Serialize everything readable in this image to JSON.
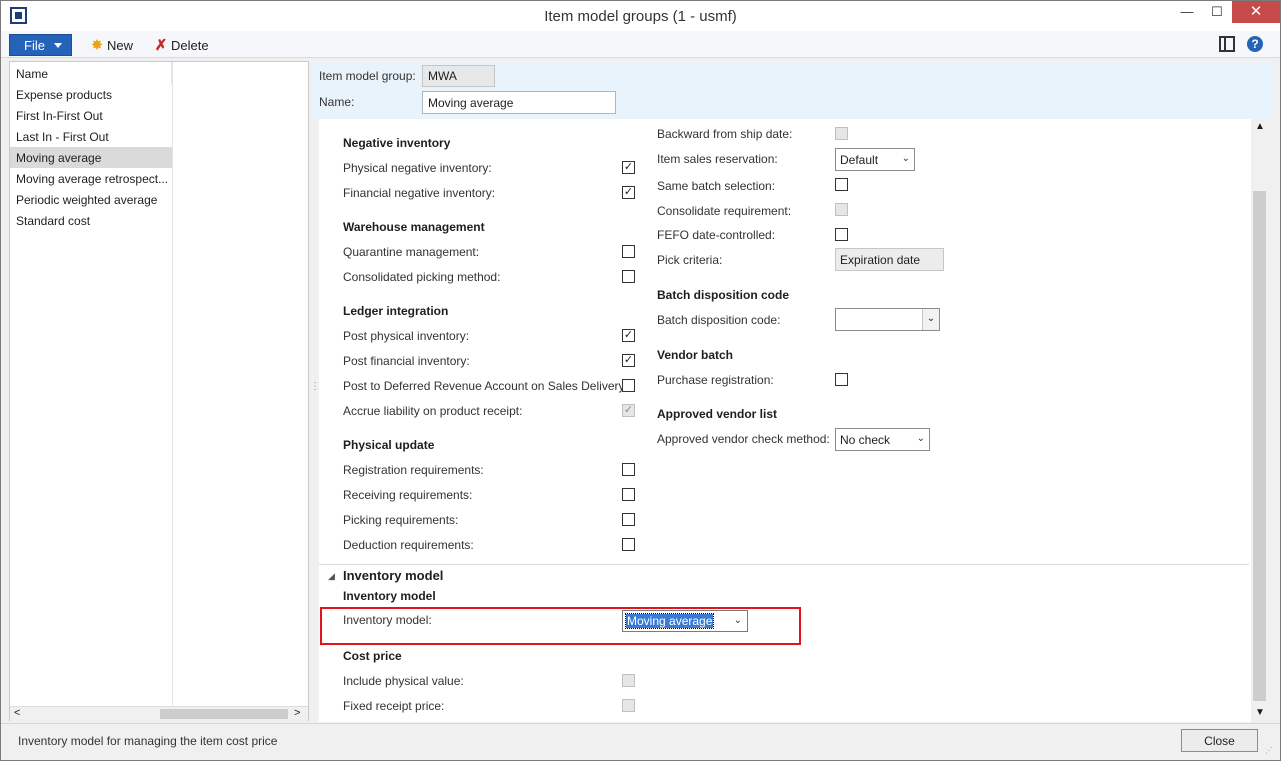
{
  "window": {
    "title": "Item model groups (1 - usmf)",
    "close_glyph": "✕",
    "min_glyph": "—",
    "max_glyph": "☐"
  },
  "toolbar": {
    "file_label": "File",
    "new_label": "New",
    "delete_label": "Delete",
    "help_glyph": "?"
  },
  "list": {
    "header": "Name",
    "items": [
      "Expense products",
      "First In-First Out",
      "Last In - First Out",
      "Moving average",
      "Moving average retrospect...",
      "Periodic weighted average",
      "Standard cost"
    ],
    "selected_index": 3
  },
  "header_fields": {
    "group_label": "Item model group:",
    "group_value": "MWA",
    "name_label": "Name:",
    "name_value": "Moving average"
  },
  "left_col": {
    "negative_inventory": {
      "title": "Negative inventory",
      "physical_label": "Physical negative inventory:",
      "physical_checked": true,
      "financial_label": "Financial negative inventory:",
      "financial_checked": true
    },
    "warehouse": {
      "title": "Warehouse management",
      "quarantine_label": "Quarantine management:",
      "quarantine_checked": false,
      "consolidated_label": "Consolidated picking method:",
      "consolidated_checked": false
    },
    "ledger": {
      "title": "Ledger integration",
      "post_physical_label": "Post physical inventory:",
      "post_physical_checked": true,
      "post_financial_label": "Post financial inventory:",
      "post_financial_checked": true,
      "deferred_label": "Post to Deferred Revenue Account on Sales Delivery:",
      "deferred_checked": false,
      "accrue_label": "Accrue liability on product receipt:",
      "accrue_checked": true
    },
    "physical_update": {
      "title": "Physical update",
      "registration_label": "Registration requirements:",
      "receiving_label": "Receiving requirements:",
      "picking_label": "Picking requirements:",
      "deduction_label": "Deduction requirements:"
    }
  },
  "right_col": {
    "backward_label": "Backward from ship date:",
    "reservation_label": "Item sales reservation:",
    "reservation_value": "Default",
    "same_batch_label": "Same batch selection:",
    "consolidate_req_label": "Consolidate requirement:",
    "fefo_label": "FEFO date-controlled:",
    "pick_criteria_label": "Pick criteria:",
    "pick_criteria_value": "Expiration date",
    "batch_disp_title": "Batch disposition code",
    "batch_disp_label": "Batch disposition code:",
    "batch_disp_value": "",
    "vendor_batch_title": "Vendor batch",
    "purchase_reg_label": "Purchase registration:",
    "approved_vendor_title": "Approved vendor list",
    "approved_method_label": "Approved vendor check method:",
    "approved_method_value": "No check"
  },
  "inventory_model_section": {
    "section_title": "Inventory model",
    "group_title": "Inventory model",
    "model_label": "Inventory model:",
    "model_value": "Moving average",
    "cost_price_title": "Cost price",
    "include_physical_label": "Include physical value:",
    "fixed_receipt_label": "Fixed receipt price:"
  },
  "status": {
    "text": "Inventory model for managing the item cost price",
    "close_label": "Close"
  },
  "glyphs": {
    "check": "✓",
    "chevron_down": "⌄",
    "tri_down": "▼",
    "tri_up": "▲",
    "tri_left": "<",
    "tri_right": ">",
    "collapse": "◢",
    "splitter": "⋮",
    "grip": "⋰"
  }
}
